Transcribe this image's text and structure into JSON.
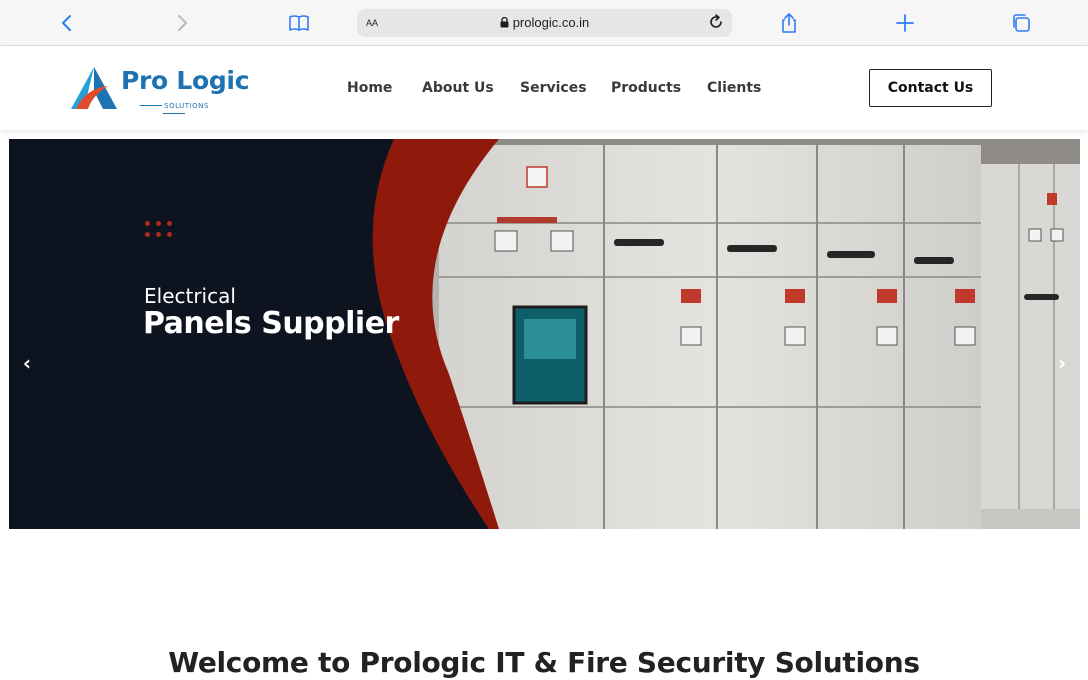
{
  "browser": {
    "address_aa": "AA",
    "url": "prologic.co.in",
    "icons": [
      "back-icon",
      "forward-icon",
      "bookmarks-icon",
      "lock-icon",
      "reload-icon",
      "share-icon",
      "new-tab-icon",
      "tabs-icon"
    ]
  },
  "header": {
    "logo_text": "Pro Logic",
    "logo_sub": "SOLUTIONS",
    "nav": [
      {
        "label": "Home"
      },
      {
        "label": "About Us"
      },
      {
        "label": "Services"
      },
      {
        "label": "Products"
      },
      {
        "label": "Clients"
      }
    ],
    "contact_label": "Contact Us"
  },
  "hero": {
    "line1": "Electrical",
    "line2": "Panels Supplier",
    "prev_icon": "chevron-left-icon",
    "next_icon": "chevron-right-icon",
    "colors": {
      "dark": "#0e1320",
      "accent": "#8f1a0c"
    }
  },
  "main": {
    "welcome_title": "Welcome to Prologic IT & Fire Security Solutions"
  }
}
